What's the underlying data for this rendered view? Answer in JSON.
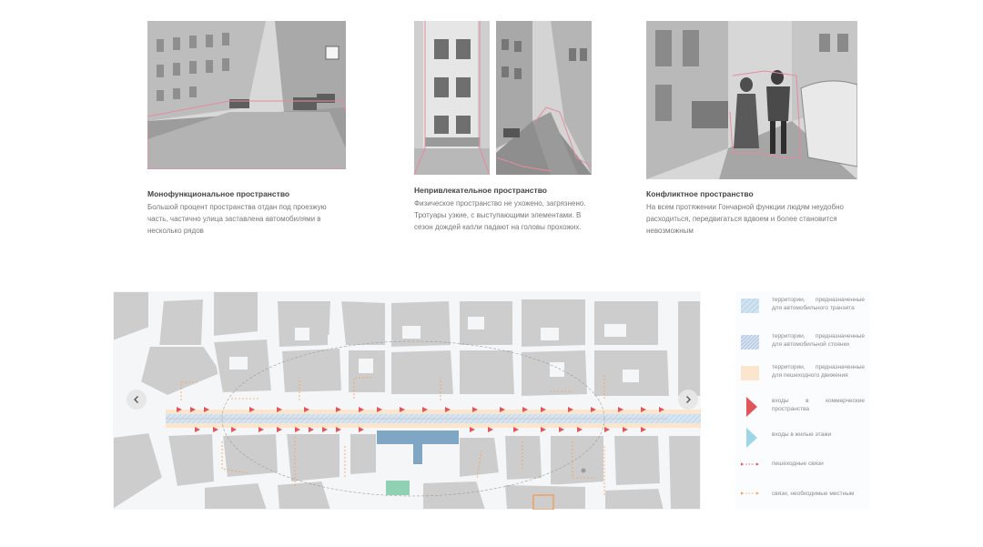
{
  "cards": [
    {
      "title": "Монофункциональное пространство",
      "text": "Большой процент пространства отдан под проезжую часть, частично улица заставлена автомобилями в несколько рядов"
    },
    {
      "title": "Непривлекательное пространство",
      "text": "Физическое пространство не ухожено, загрязнено. Тротуары узкие, с выступающими элементами. В сезон дождей капли падают на головы прохожих."
    },
    {
      "title": "Конфликтное пространство",
      "text": "На всем протяжении Гончарной функции людям неудобно расходиться, передвигаться вдвоем и более становится невозможным"
    }
  ],
  "carousel": {
    "prev_icon": "chevron-left-icon",
    "next_icon": "chevron-right-icon"
  },
  "legend": [
    {
      "label": "территории, предназначенные для автомобильного транзита",
      "swatch": "light-blue-hatched",
      "color": "#cfe3f1"
    },
    {
      "label": "территории, предназначенные для автомобильной стоянки",
      "swatch": "blue-hatched",
      "color": "#c9d7ea"
    },
    {
      "label": "территории, предназначенные для пешеходного движения",
      "swatch": "peach",
      "color": "#fbe5cd"
    },
    {
      "label": "входы в коммерческие пространства",
      "swatch": "red-triangle",
      "color": "#e0565b"
    },
    {
      "label": "входы в жилые этажи",
      "swatch": "cyan-triangle",
      "color": "#9fd6e6"
    },
    {
      "label": "пешеходные связи",
      "swatch": "red-dashed-arrows",
      "color": "#e0565b"
    },
    {
      "label": "связи, необходимые местным",
      "swatch": "orange-dashed-arrows",
      "color": "#f0a060"
    }
  ],
  "colors": {
    "building": "#cdcdcd",
    "street": "#cfe3f1",
    "sidewalk": "#fbe5cd",
    "entry_red": "#e0565b",
    "highlight_blue": "#7fa7c4",
    "highlight_green": "#8fd1b2",
    "pink_outline": "#e58b9c"
  }
}
